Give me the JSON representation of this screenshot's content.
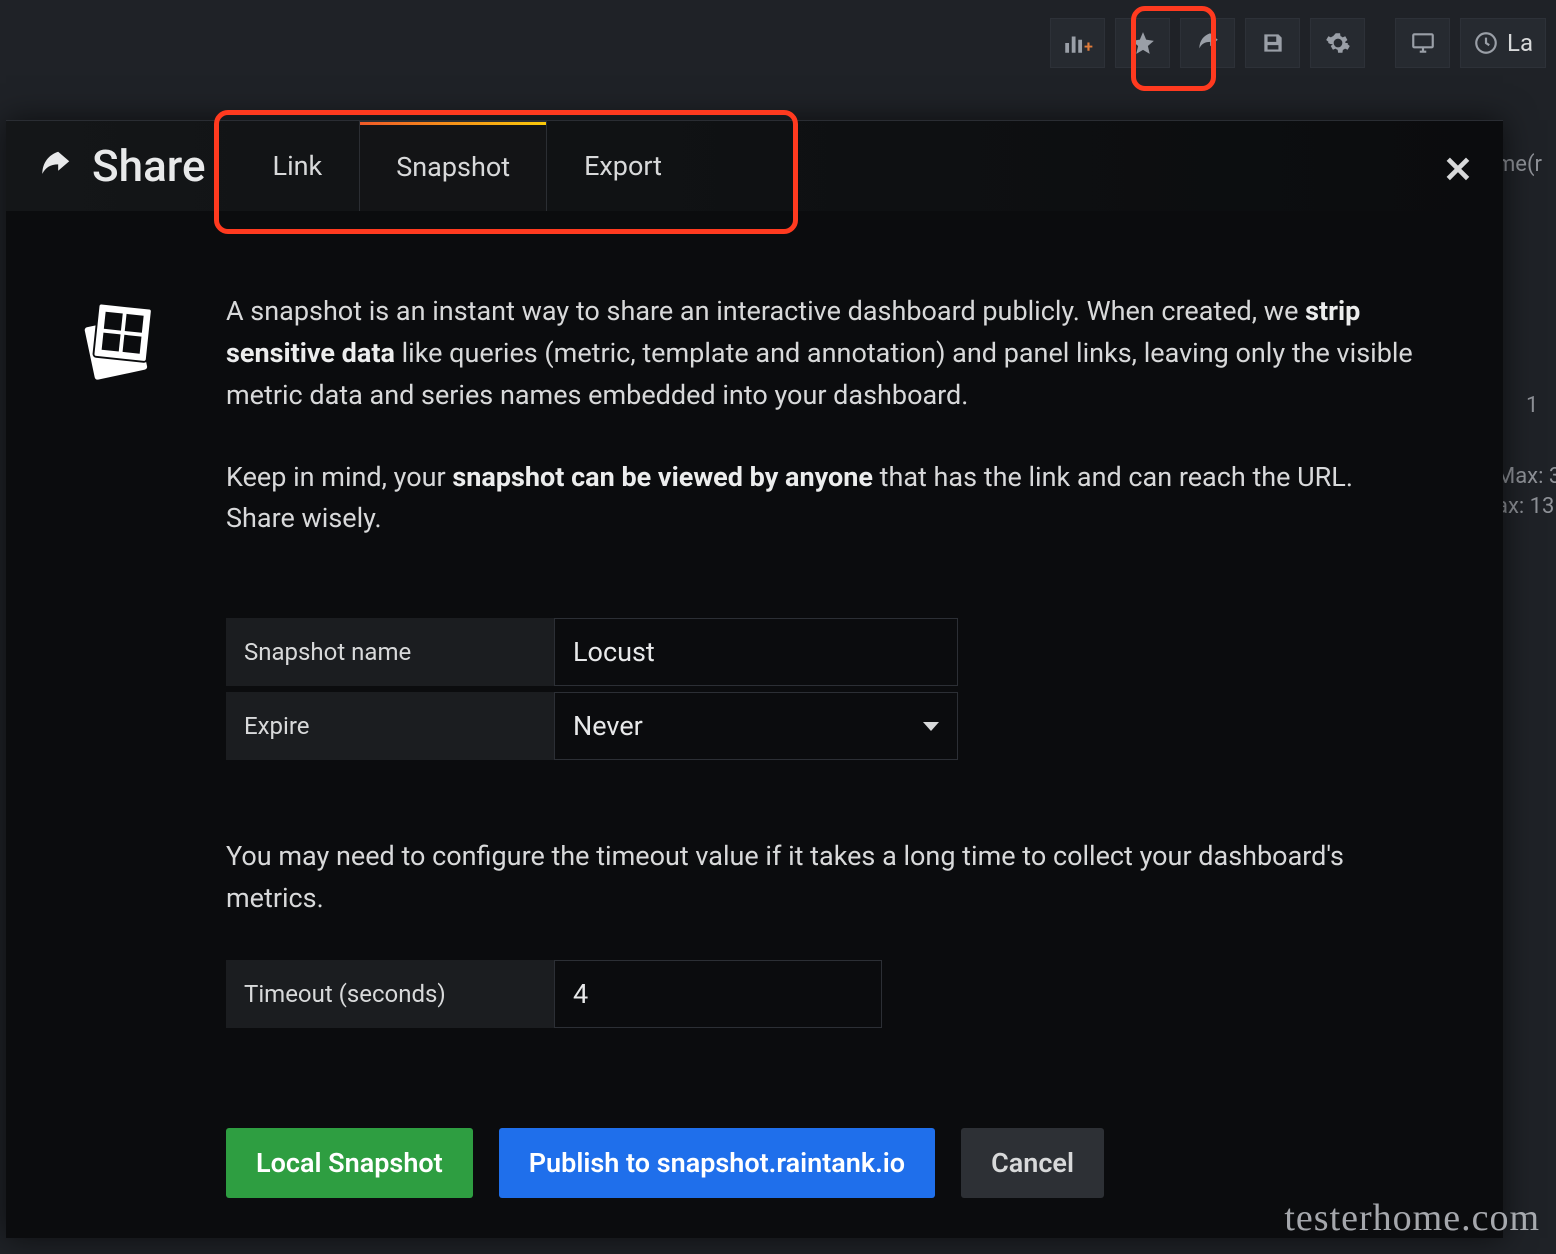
{
  "toolbar": {
    "range_label": "La"
  },
  "background": {
    "right_labels": [
      "me(r",
      "1",
      "Max: 3",
      "ax: 13"
    ]
  },
  "modal": {
    "title": "Share",
    "tabs": {
      "link": "Link",
      "snapshot": "Snapshot",
      "export": "Export"
    },
    "active_tab": "snapshot",
    "desc1_a": "A snapshot is an instant way to share an interactive dashboard publicly. When created, we ",
    "desc1_b": "strip sensitive data",
    "desc1_c": " like queries (metric, template and annotation) and panel links, leaving only the visible metric data and series names embedded into your dashboard.",
    "desc2_a": "Keep in mind, your ",
    "desc2_b": "snapshot can be viewed by anyone",
    "desc2_c": " that has the link and can reach the URL. Share wisely.",
    "form": {
      "name_label": "Snapshot name",
      "name_value": "Locust",
      "expire_label": "Expire",
      "expire_value": "Never",
      "timeout_note": "You may need to configure the timeout value if it takes a long time to collect your dashboard's metrics.",
      "timeout_label": "Timeout (seconds)",
      "timeout_value": "4"
    },
    "actions": {
      "local": "Local Snapshot",
      "publish": "Publish to snapshot.raintank.io",
      "cancel": "Cancel"
    }
  },
  "watermark": "testerhome.com"
}
